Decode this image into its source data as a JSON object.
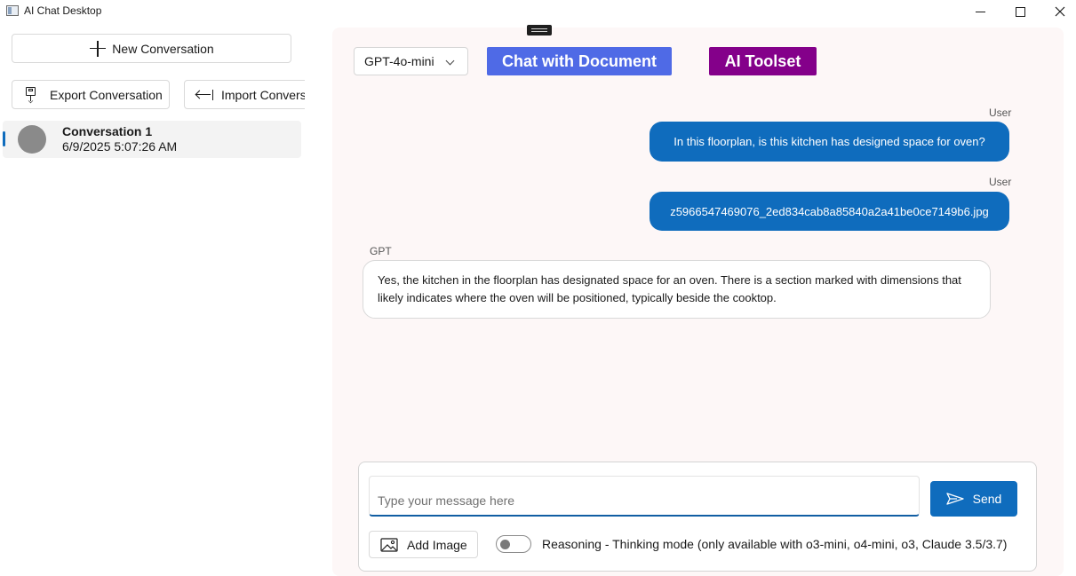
{
  "window": {
    "title": "AI Chat Desktop"
  },
  "sidebar": {
    "new_conversation_label": "New Conversation",
    "export_label": "Export Conversation",
    "import_label": "Import Conversation",
    "conversations": [
      {
        "title": "Conversation 1",
        "timestamp": "6/9/2025 5:07:26 AM",
        "selected": true
      }
    ]
  },
  "toolbar": {
    "model_selected": "GPT-4o-mini",
    "chat_with_document_label": "Chat with Document",
    "ai_toolset_label": "AI Toolset",
    "chat_with_document_color": "#4f6ae6",
    "ai_toolset_color": "#84008a"
  },
  "messages": [
    {
      "sender": "User",
      "text": "In this floorplan, is this kitchen has designed space for oven?"
    },
    {
      "sender": "User",
      "text": "z5966547469076_2ed834cab8a85840a2a41be0ce7149b6.jpg"
    },
    {
      "sender": "GPT",
      "text": "Yes, the kitchen in the floorplan has designated space for an oven. There is a section marked with dimensions that likely indicates where the oven will be positioned, typically beside the cooktop."
    }
  ],
  "composer": {
    "placeholder": "Type your message here",
    "value": "",
    "send_label": "Send",
    "add_image_label": "Add Image",
    "reasoning_enabled": false,
    "reasoning_label": "Reasoning - Thinking mode (only available with o3-mini, o4-mini, o3, Claude 3.5/3.7)"
  },
  "colors": {
    "accent": "#0f6cbd",
    "chat_background": "#fdf7f7"
  }
}
